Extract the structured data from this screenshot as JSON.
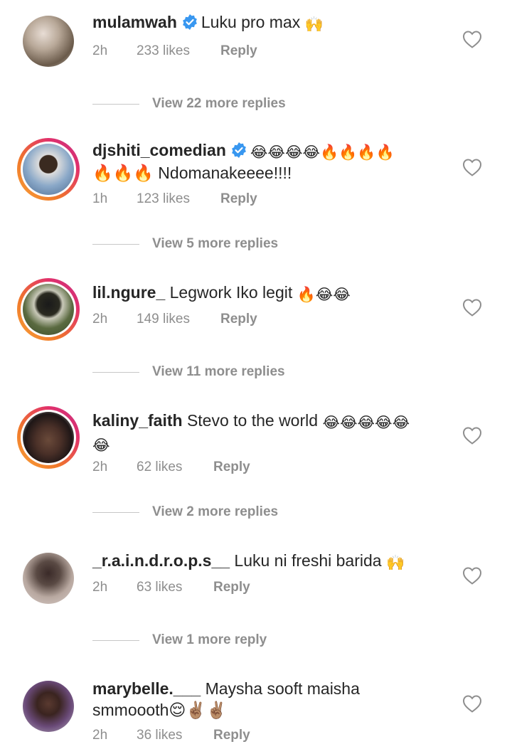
{
  "comments": [
    {
      "username": "mulamwah",
      "verified": true,
      "text": "Luku pro max",
      "emojis": "🙌",
      "text_line2": "",
      "time": "2h",
      "likes": "233 likes",
      "reply_label": "Reply",
      "view_more": "View 22 more replies",
      "story_ring": false,
      "avatar_color": "#7a6a5a"
    },
    {
      "username": "djshiti_comedian",
      "verified": true,
      "text": "",
      "emojis": "😂😂😂😂🔥🔥🔥🔥",
      "text_line2": "🔥🔥🔥 Ndomanakeeee!!!!",
      "time": "1h",
      "likes": "123 likes",
      "reply_label": "Reply",
      "view_more": "View 5 more replies",
      "story_ring": true,
      "avatar_color": "#5a86b0"
    },
    {
      "username": "lil.ngure_",
      "verified": false,
      "text": "Legwork Iko legit",
      "emojis": "🔥😂😂",
      "text_line2": "",
      "time": "2h",
      "likes": "149 likes",
      "reply_label": "Reply",
      "view_more": "View 11 more replies",
      "story_ring": true,
      "avatar_color": "#4c5a3a"
    },
    {
      "username": "kaliny_faith",
      "verified": false,
      "text": "Stevo to the world",
      "emojis": "😂😂😂😂😂",
      "text_line2": "😂",
      "time": "2h",
      "likes": "62 likes",
      "reply_label": "Reply",
      "view_more": "View 2 more replies",
      "story_ring": true,
      "avatar_color": "#3a2a26"
    },
    {
      "username": "_r.a.i.n.d.r.o.p.s__",
      "verified": false,
      "text": "Luku ni freshi barida",
      "emojis": "🙌",
      "text_line2": "",
      "time": "2h",
      "likes": "63 likes",
      "reply_label": "Reply",
      "view_more": "View 1 more reply",
      "story_ring": false,
      "avatar_color": "#8a7a70"
    },
    {
      "username": "marybelle.___",
      "verified": false,
      "text": "Maysha sooft maisha",
      "emojis": "",
      "text_line2": "smmoooth😌✌🏽✌🏽",
      "time": "2h",
      "likes": "36 likes",
      "reply_label": "Reply",
      "view_more": "",
      "story_ring": false,
      "avatar_color": "#5a4a5a"
    }
  ],
  "colors": {
    "text": "#262626",
    "meta": "#8e8e8e",
    "verified_blue": "#3897f0",
    "divider": "#c7c7c7"
  },
  "icons": {
    "like": "heart-outline-icon",
    "verified": "verified-badge-icon"
  }
}
